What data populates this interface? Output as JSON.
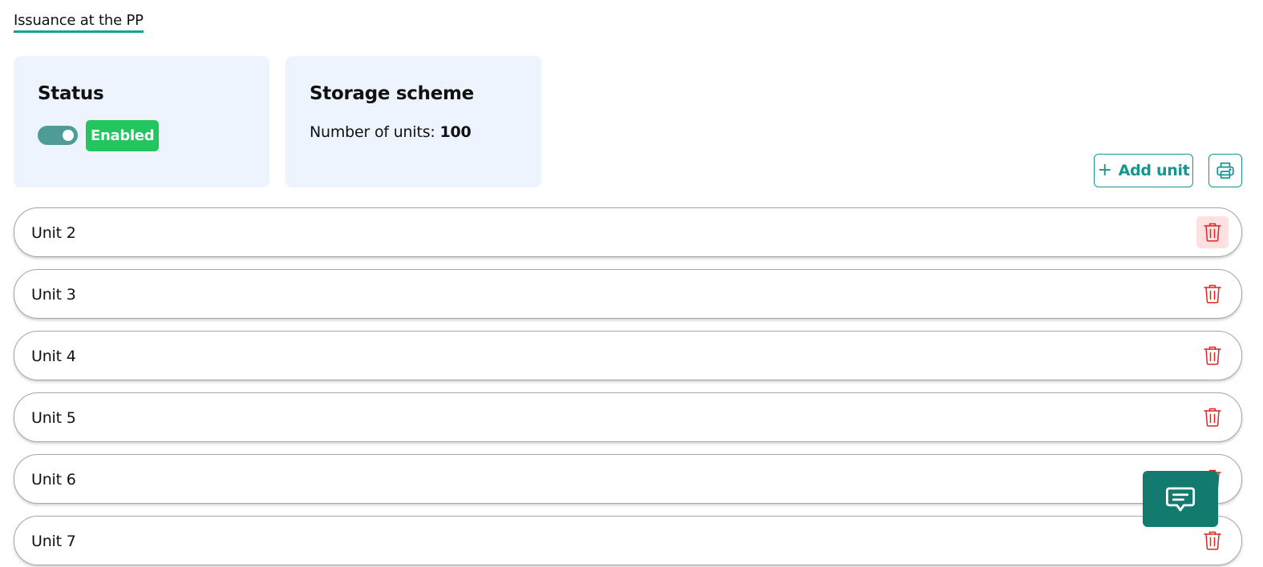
{
  "tabs": {
    "active": "Issuance at the PP"
  },
  "status_card": {
    "title": "Status",
    "toggle_on": true,
    "badge": "Enabled",
    "badge_color": "#22c55e"
  },
  "storage_card": {
    "title": "Storage scheme",
    "units_label": "Number of units:",
    "units_value": "100"
  },
  "actions": {
    "add_unit_label": "Add unit",
    "add_icon": "plus-icon",
    "print_icon": "printer-icon"
  },
  "units": [
    {
      "label": "Unit 2"
    },
    {
      "label": "Unit 3"
    },
    {
      "label": "Unit 4"
    },
    {
      "label": "Unit 5"
    },
    {
      "label": "Unit 6"
    },
    {
      "label": "Unit 7"
    }
  ],
  "colors": {
    "accent": "#14968e",
    "delete": "#dc2626",
    "chat": "#137a70",
    "card_bg": "#eef4fe"
  },
  "chat": {
    "icon": "chat-bubble-icon"
  }
}
